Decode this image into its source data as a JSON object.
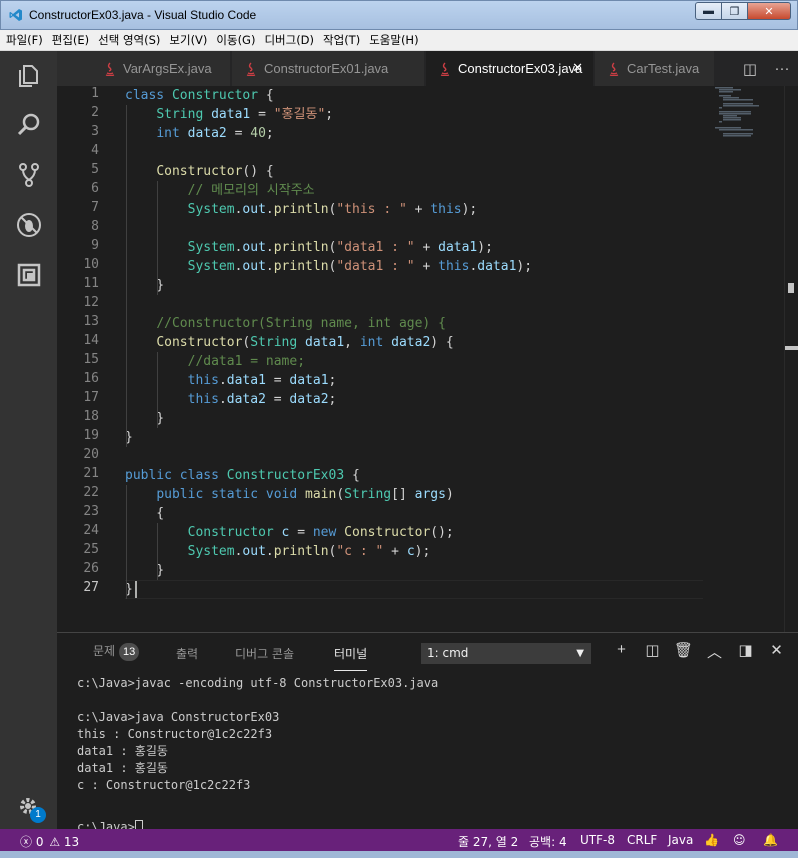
{
  "window": {
    "title": "ConstructorEx03.java - Visual Studio Code",
    "minimize": "▬",
    "maximize": "❐",
    "close": "✕"
  },
  "menu": [
    "파일(F)",
    "편집(E)",
    "선택 영역(S)",
    "보기(V)",
    "이동(G)",
    "디버그(D)",
    "작업(T)",
    "도움말(H)"
  ],
  "activity": [
    "explorer-icon",
    "search-icon",
    "source-control-icon",
    "debug-icon",
    "extensions-icon",
    "settings-gear-icon"
  ],
  "settings_badge": "1",
  "tabs": [
    {
      "label": "VarArgsEx.java",
      "active": false
    },
    {
      "label": "ConstructorEx01.java",
      "active": false
    },
    {
      "label": "ConstructorEx03.java",
      "active": true,
      "close": "✕"
    },
    {
      "label": "CarTest.java",
      "active": false
    }
  ],
  "tab_actions": {
    "split": "◫",
    "more": "···"
  },
  "editor": {
    "current_line": 27,
    "lines": [
      [
        [
          "kw",
          "class "
        ],
        [
          "ty",
          "Constructor "
        ],
        [
          "pl",
          "{"
        ]
      ],
      [
        [
          "pl",
          "    "
        ],
        [
          "ty",
          "String "
        ],
        [
          "var",
          "data1 "
        ],
        [
          "pl",
          "= "
        ],
        [
          "str",
          "\"홍길동\""
        ],
        [
          "pl",
          ";"
        ]
      ],
      [
        [
          "pl",
          "    "
        ],
        [
          "kw",
          "int "
        ],
        [
          "var",
          "data2 "
        ],
        [
          "pl",
          "= "
        ],
        [
          "num",
          "40"
        ],
        [
          "pl",
          ";"
        ]
      ],
      [],
      [
        [
          "pl",
          "    "
        ],
        [
          "fn",
          "Constructor"
        ],
        [
          "pl",
          "() {"
        ]
      ],
      [
        [
          "pl",
          "        "
        ],
        [
          "com",
          "// 메모리의 시작주소"
        ]
      ],
      [
        [
          "pl",
          "        "
        ],
        [
          "ty",
          "System"
        ],
        [
          "pl",
          "."
        ],
        [
          "var",
          "out"
        ],
        [
          "pl",
          "."
        ],
        [
          "fn",
          "println"
        ],
        [
          "pl",
          "("
        ],
        [
          "str",
          "\"this : \""
        ],
        [
          "pl",
          " + "
        ],
        [
          "kw",
          "this"
        ],
        [
          "pl",
          ");"
        ]
      ],
      [],
      [
        [
          "pl",
          "        "
        ],
        [
          "ty",
          "System"
        ],
        [
          "pl",
          "."
        ],
        [
          "var",
          "out"
        ],
        [
          "pl",
          "."
        ],
        [
          "fn",
          "println"
        ],
        [
          "pl",
          "("
        ],
        [
          "str",
          "\"data1 : \""
        ],
        [
          "pl",
          " + "
        ],
        [
          "var",
          "data1"
        ],
        [
          "pl",
          ");"
        ]
      ],
      [
        [
          "pl",
          "        "
        ],
        [
          "ty",
          "System"
        ],
        [
          "pl",
          "."
        ],
        [
          "var",
          "out"
        ],
        [
          "pl",
          "."
        ],
        [
          "fn",
          "println"
        ],
        [
          "pl",
          "("
        ],
        [
          "str",
          "\"data1 : \""
        ],
        [
          "pl",
          " + "
        ],
        [
          "kw",
          "this"
        ],
        [
          "pl",
          "."
        ],
        [
          "var",
          "data1"
        ],
        [
          "pl",
          ");"
        ]
      ],
      [
        [
          "pl",
          "    }"
        ]
      ],
      [],
      [
        [
          "pl",
          "    "
        ],
        [
          "com",
          "//Constructor(String name, int age) {"
        ]
      ],
      [
        [
          "pl",
          "    "
        ],
        [
          "fn",
          "Constructor"
        ],
        [
          "pl",
          "("
        ],
        [
          "ty",
          "String "
        ],
        [
          "var",
          "data1"
        ],
        [
          "pl",
          ", "
        ],
        [
          "kw",
          "int "
        ],
        [
          "var",
          "data2"
        ],
        [
          "pl",
          ") {"
        ]
      ],
      [
        [
          "pl",
          "        "
        ],
        [
          "com",
          "//data1 = name;"
        ]
      ],
      [
        [
          "pl",
          "        "
        ],
        [
          "kw",
          "this"
        ],
        [
          "pl",
          "."
        ],
        [
          "var",
          "data1 "
        ],
        [
          "pl",
          "= "
        ],
        [
          "var",
          "data1"
        ],
        [
          "pl",
          ";"
        ]
      ],
      [
        [
          "pl",
          "        "
        ],
        [
          "kw",
          "this"
        ],
        [
          "pl",
          "."
        ],
        [
          "var",
          "data2 "
        ],
        [
          "pl",
          "= "
        ],
        [
          "var",
          "data2"
        ],
        [
          "pl",
          ";"
        ]
      ],
      [
        [
          "pl",
          "    }"
        ]
      ],
      [
        [
          "pl",
          "}"
        ]
      ],
      [],
      [
        [
          "kw",
          "public class "
        ],
        [
          "ty",
          "ConstructorEx03 "
        ],
        [
          "pl",
          "{"
        ]
      ],
      [
        [
          "pl",
          "    "
        ],
        [
          "kw",
          "public static void "
        ],
        [
          "fn",
          "main"
        ],
        [
          "pl",
          "("
        ],
        [
          "ty",
          "String"
        ],
        [
          "pl",
          "[] "
        ],
        [
          "var",
          "args"
        ],
        [
          "pl",
          ")"
        ]
      ],
      [
        [
          "pl",
          "    {"
        ]
      ],
      [
        [
          "pl",
          "        "
        ],
        [
          "ty",
          "Constructor "
        ],
        [
          "var",
          "c "
        ],
        [
          "pl",
          "= "
        ],
        [
          "kw",
          "new "
        ],
        [
          "fn",
          "Constructor"
        ],
        [
          "pl",
          "();"
        ]
      ],
      [
        [
          "pl",
          "        "
        ],
        [
          "ty",
          "System"
        ],
        [
          "pl",
          "."
        ],
        [
          "var",
          "out"
        ],
        [
          "pl",
          "."
        ],
        [
          "fn",
          "println"
        ],
        [
          "pl",
          "("
        ],
        [
          "str",
          "\"c : \""
        ],
        [
          "pl",
          " + "
        ],
        [
          "var",
          "c"
        ],
        [
          "pl",
          ");"
        ]
      ],
      [
        [
          "pl",
          "    }"
        ]
      ],
      [
        [
          "pl",
          "}"
        ]
      ]
    ]
  },
  "panel": {
    "tabs": [
      {
        "label": "문제",
        "badge": "13"
      },
      {
        "label": "출력"
      },
      {
        "label": "디버그 콘솔"
      },
      {
        "label": "터미널",
        "active": true
      }
    ],
    "terminal_select": "1: cmd",
    "actions": [
      "+",
      "◫",
      "🗑",
      "︿",
      "◨",
      "✕"
    ],
    "terminal_lines": [
      "c:\\Java>javac -encoding utf-8 ConstructorEx03.java",
      "",
      "c:\\Java>java ConstructorEx03",
      "this : Constructor@1c2c22f3",
      "data1 : 홍길동",
      "data1 : 홍길동",
      "c : Constructor@1c2c22f3",
      "",
      "c:\\Java>"
    ]
  },
  "status": {
    "errors": "0",
    "warnings": "13",
    "position": "줄 27, 열 2",
    "spaces": "공백: 4",
    "encoding": "UTF-8",
    "eol": "CRLF",
    "language": "Java"
  },
  "colors": {
    "status_bg": "#68217a",
    "editor_bg": "#1e1e1e",
    "activity_bg": "#333333"
  }
}
